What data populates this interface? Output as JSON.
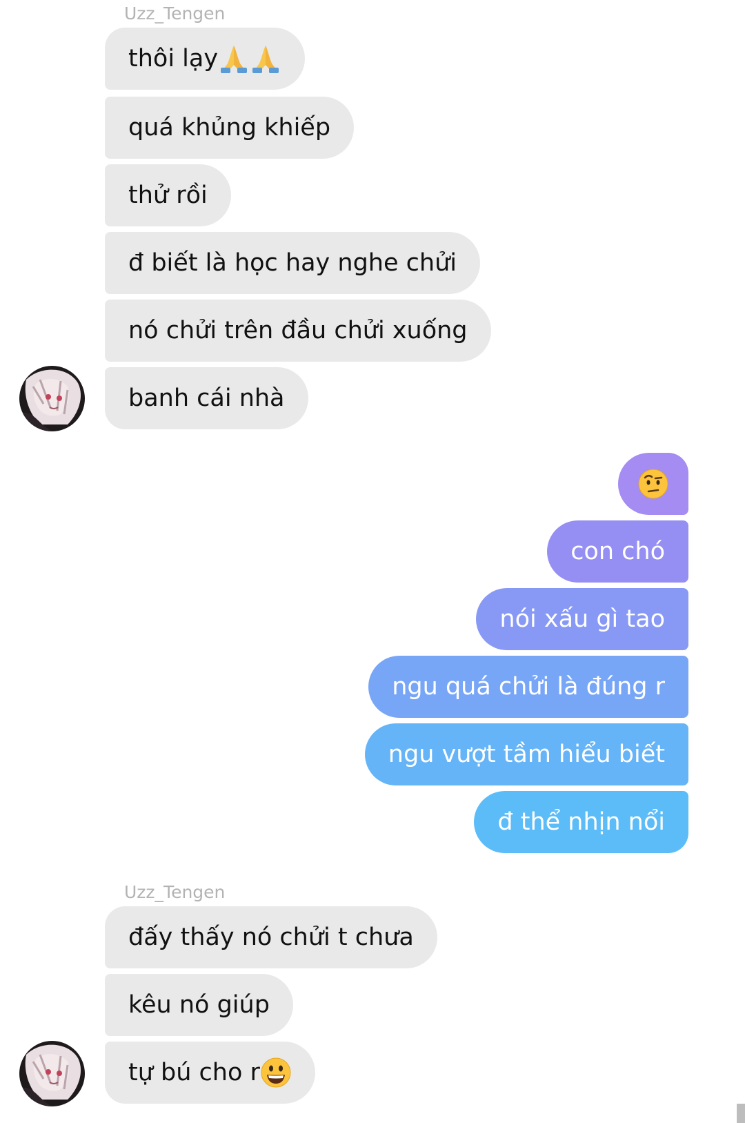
{
  "chat": {
    "group1": {
      "sender": "Uzz_Tengen",
      "messages": [
        "thôi lạy",
        "quá khủng khiếp",
        "thử rồi",
        "đ biết là học hay nghe chửi",
        "nó chửi trên đầu chửi xuống",
        "banh cái nhà"
      ],
      "emoji_first": "folded-hands-icon x2"
    },
    "outgoing": {
      "messages": [
        "🤨",
        "con chó",
        "nói xấu gì tao",
        "ngu quá chửi là đúng r",
        "ngu vượt tầm hiểu biết",
        "đ thể nhịn nổi"
      ],
      "gradient_colors": [
        "#a48cf2",
        "#958ff4",
        "#8899f5",
        "#78a6f7",
        "#66b4f8",
        "#5bbcf8"
      ]
    },
    "group2": {
      "sender": "Uzz_Tengen",
      "messages": [
        "đấy thấy nó chửi t chưa",
        "kêu nó giúp",
        "tự bú cho r"
      ],
      "emoji_last": "grinning-face-icon"
    }
  },
  "colors": {
    "incoming_bubble": "#e9e9e9",
    "sender_name": "#b3b3b3",
    "background": "#ffffff"
  }
}
